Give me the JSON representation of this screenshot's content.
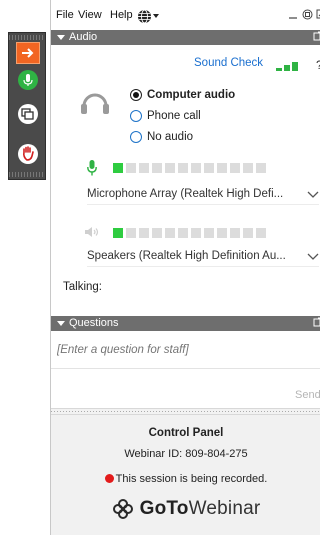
{
  "menu": {
    "file": "File",
    "view": "View",
    "help": "Help"
  },
  "audio": {
    "header": "Audio",
    "sound_check": "Sound Check",
    "help_glyph": "?",
    "options": [
      {
        "label": "Computer audio",
        "selected": true
      },
      {
        "label": "Phone call",
        "selected": false
      },
      {
        "label": "No audio",
        "selected": false
      }
    ],
    "mic_level": 0.08,
    "speaker_level": 0.08,
    "microphone_device": "Microphone Array (Realtek High Defi...",
    "speaker_device": "Speakers (Realtek High Definition Au...",
    "talking_label": "Talking:"
  },
  "questions": {
    "header": "Questions",
    "placeholder": "[Enter a question for staff]",
    "send_label": "Send"
  },
  "footer": {
    "title": "Control Panel",
    "webinar_id": "Webinar ID: 809-804-275",
    "recording": "This session is being recorded.",
    "brand_goto": "GoTo",
    "brand_webinar": "Webinar"
  },
  "colors": {
    "accent_orange": "#f26522",
    "link_blue": "#1a6fcf",
    "meter_green": "#2ecc40",
    "header_gray": "#6e6e6e",
    "record_red": "#e31b1b"
  },
  "icons": [
    "arrow-right-icon",
    "microphone-icon",
    "screen-share-icon",
    "raise-hand-icon",
    "globe-icon",
    "headset-icon",
    "speaker-icon",
    "chevron-down-icon",
    "popout-icon"
  ]
}
